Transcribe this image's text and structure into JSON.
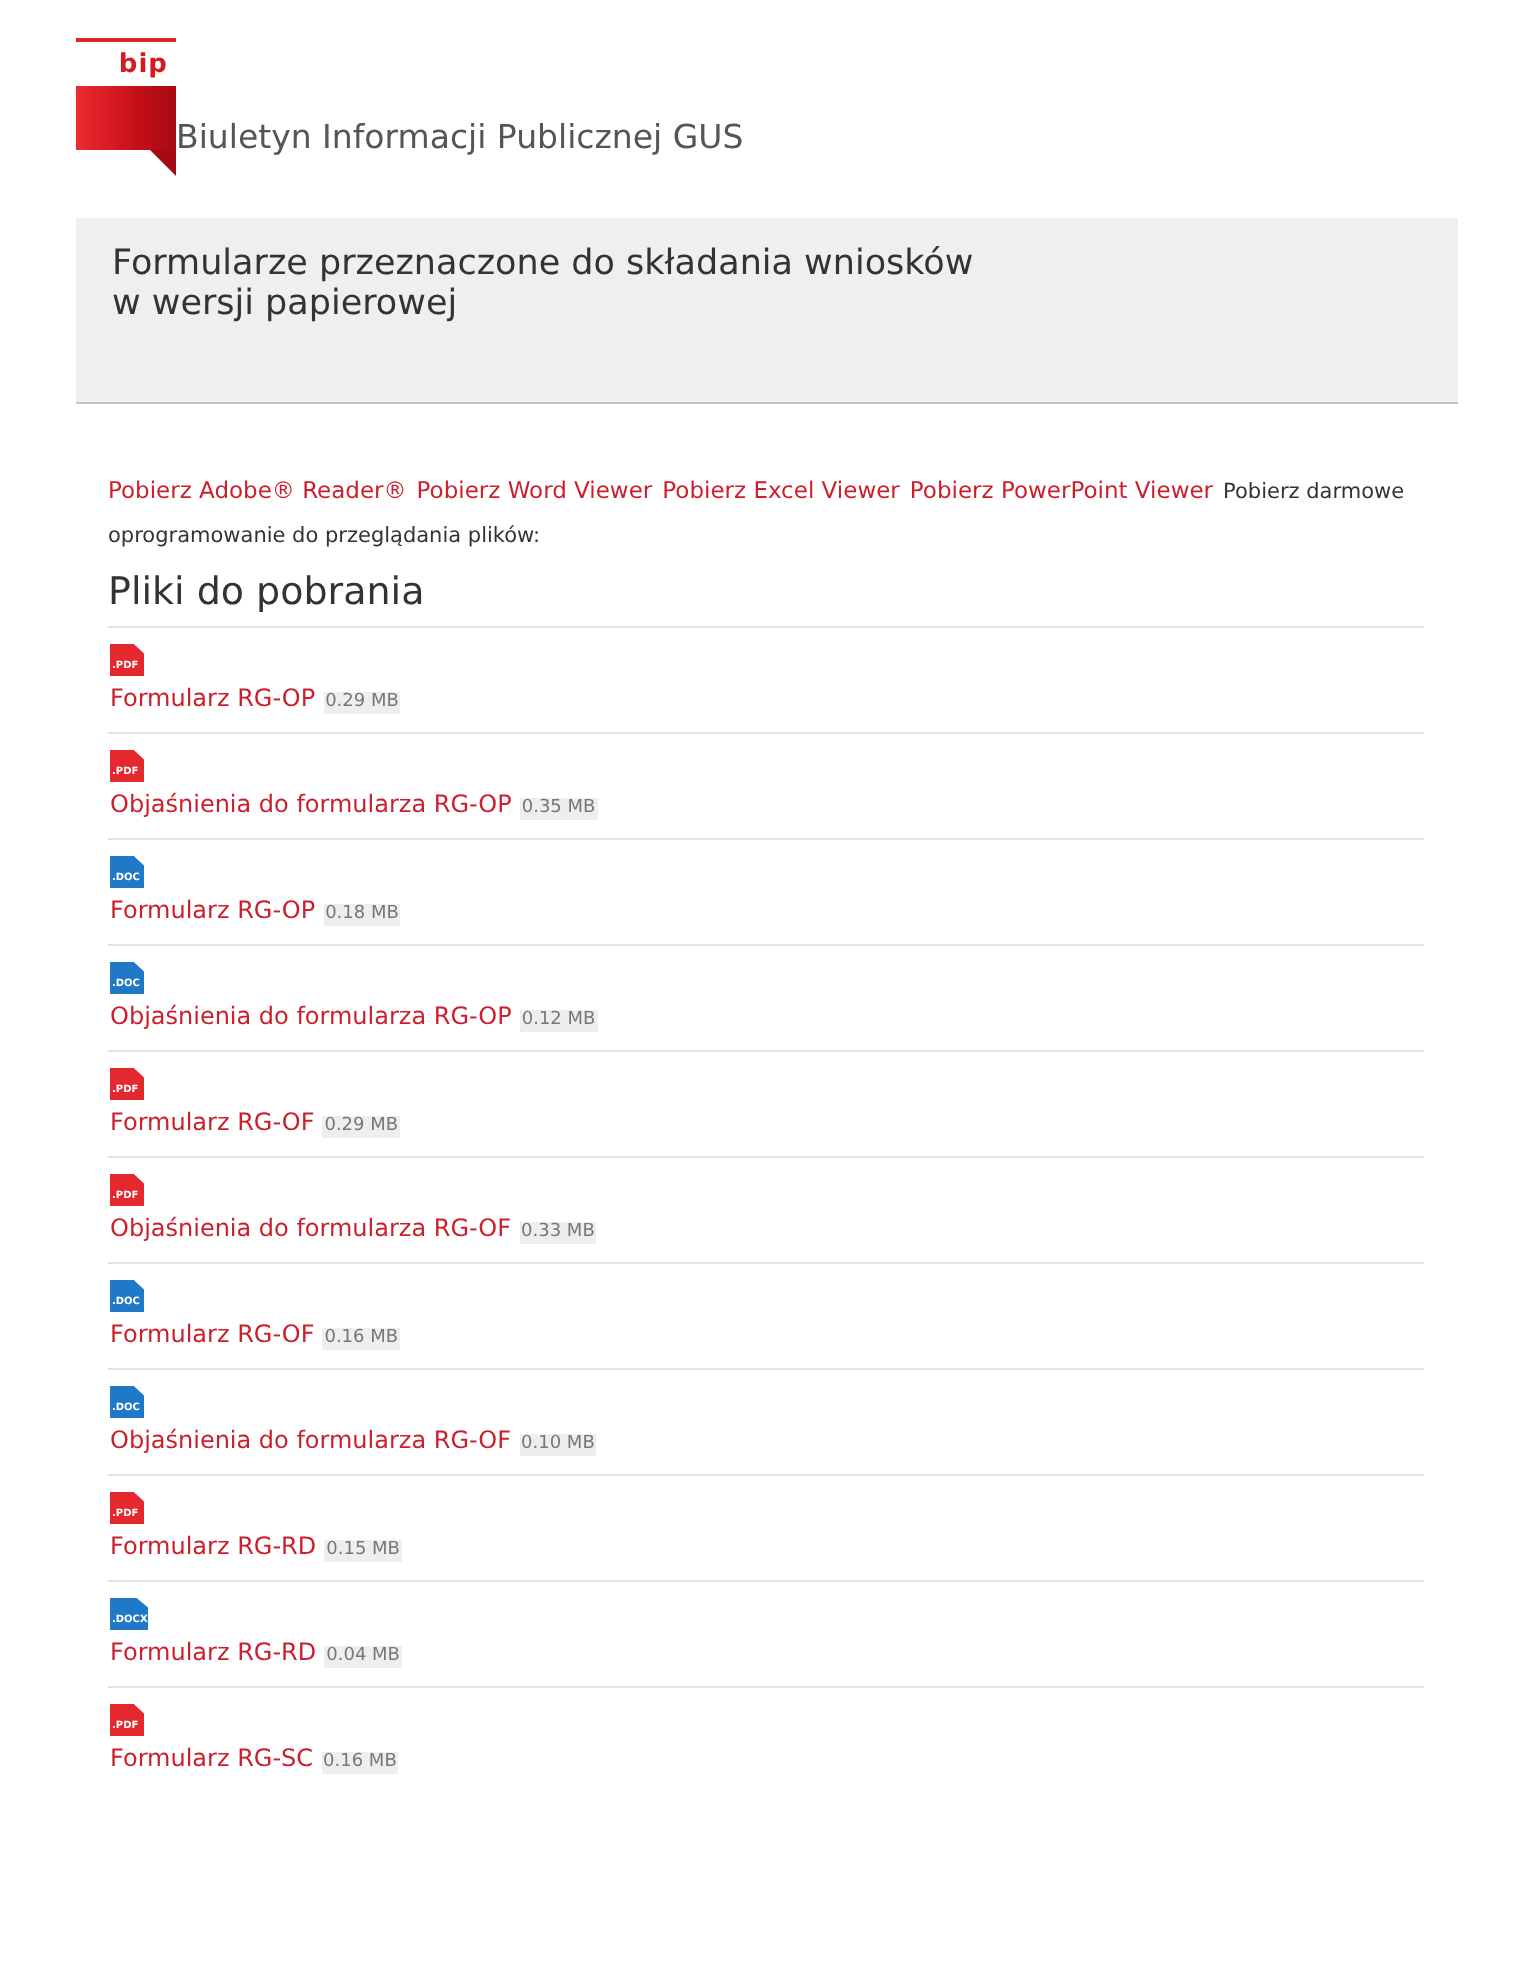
{
  "header": {
    "logo_text": "bip",
    "site_title": "Biuletyn Informacji Publicznej GUS"
  },
  "page_title": "Formularze przeznaczone do składania wniosków\nw wersji papierowej",
  "software": {
    "links": [
      "Pobierz Adobe® Reader®",
      "Pobierz Word Viewer",
      "Pobierz Excel Viewer",
      "Pobierz PowerPoint Viewer"
    ],
    "note": "Pobierz darmowe oprogramowanie do przeglądania plików:"
  },
  "downloads": {
    "heading": "Pliki do pobrania",
    "files": [
      {
        "kind": "pdf",
        "badge": ".PDF",
        "name": "Formularz RG-OP",
        "size": "0.29 MB"
      },
      {
        "kind": "pdf",
        "badge": ".PDF",
        "name": "Objaśnienia do formularza RG-OP",
        "size": "0.35 MB"
      },
      {
        "kind": "doc",
        "badge": ".DOC",
        "name": "Formularz RG-OP",
        "size": "0.18 MB"
      },
      {
        "kind": "doc",
        "badge": ".DOC",
        "name": "Objaśnienia do formularza RG-OP",
        "size": "0.12 MB"
      },
      {
        "kind": "pdf",
        "badge": ".PDF",
        "name": "Formularz RG-OF",
        "size": "0.29 MB"
      },
      {
        "kind": "pdf",
        "badge": ".PDF",
        "name": "Objaśnienia do formularza RG-OF",
        "size": "0.33 MB"
      },
      {
        "kind": "doc",
        "badge": ".DOC",
        "name": "Formularz RG-OF",
        "size": "0.16 MB"
      },
      {
        "kind": "doc",
        "badge": ".DOC",
        "name": "Objaśnienia do formularza RG-OF",
        "size": "0.10 MB"
      },
      {
        "kind": "pdf",
        "badge": ".PDF",
        "name": "Formularz RG-RD",
        "size": "0.15 MB"
      },
      {
        "kind": "docx",
        "badge": ".DOCX",
        "name": "Formularz RG-RD",
        "size": "0.04 MB"
      },
      {
        "kind": "pdf",
        "badge": ".PDF",
        "name": "Formularz RG-SC",
        "size": "0.16 MB"
      }
    ]
  }
}
